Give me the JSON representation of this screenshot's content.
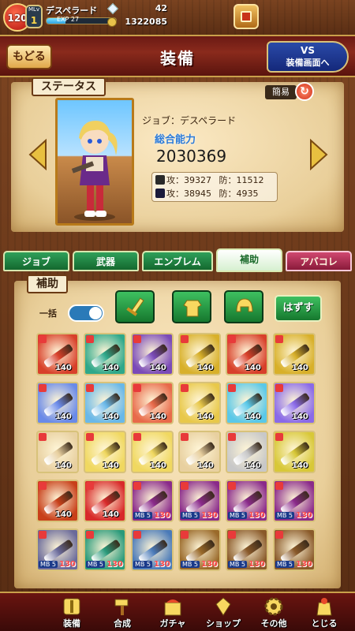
{
  "topbar": {
    "rank": "120",
    "mlv_label": "MLv",
    "mlv_value": "1",
    "player_name": "デスペラード",
    "exp_label": "EXP 27",
    "exp_fraction": 0.27,
    "gems": "42",
    "gold": "1322085"
  },
  "header": {
    "back_label": "もどる",
    "title": "装備",
    "vs_line1": "VS",
    "vs_line2": "装備画面へ"
  },
  "status": {
    "tag": "ステータス",
    "simple_label": "簡易",
    "job": "ジョブ：デスペラード",
    "power_label": "総合能力",
    "power_value": "2030369",
    "row1_attack": "攻：39327",
    "row1_defense": "防：11512",
    "row2_attack": "攻：38945",
    "row2_defense": "防：4935"
  },
  "tabs": [
    {
      "label": "ジョブ",
      "active": false
    },
    {
      "label": "武器",
      "active": false
    },
    {
      "label": "エンブレム",
      "active": false
    },
    {
      "label": "補助",
      "active": true
    },
    {
      "label": "アバコレ",
      "active": false
    }
  ],
  "inventory": {
    "tag": "補助",
    "bulk_label": "一括",
    "bulk_on": true,
    "unequip_label": "はずす",
    "filter_icons": [
      "sword-icon",
      "armor-icon",
      "helmet-icon"
    ],
    "items": [
      {
        "lv": "140",
        "color": "#d8402a"
      },
      {
        "lv": "140",
        "color": "#2fa88a"
      },
      {
        "lv": "140",
        "color": "#7a4ab8"
      },
      {
        "lv": "140",
        "color": "#d8b02a"
      },
      {
        "lv": "140",
        "color": "#d8402a"
      },
      {
        "lv": "140",
        "color": "#d8b02a"
      },
      {
        "lv": "140",
        "color": "#6a8ae8"
      },
      {
        "lv": "140",
        "color": "#6ab8e8"
      },
      {
        "lv": "140",
        "color": "#e86a4a"
      },
      {
        "lv": "140",
        "color": "#e8c84a"
      },
      {
        "lv": "140",
        "color": "#5ac8e8"
      },
      {
        "lv": "140",
        "color": "#8a6ae8"
      },
      {
        "lv": "140",
        "color": "#e8d0a0"
      },
      {
        "lv": "140",
        "color": "#f0d860"
      },
      {
        "lv": "140",
        "color": "#f0d860"
      },
      {
        "lv": "140",
        "color": "#e8d0a0"
      },
      {
        "lv": "140",
        "color": "#c8c8c8"
      },
      {
        "lv": "140",
        "color": "#d8c838"
      },
      {
        "lv": "140",
        "color": "#c8401a"
      },
      {
        "lv": "140",
        "color": "#d82a2a"
      },
      {
        "mb": "MB 5",
        "n": "130",
        "color": "#8a2a8a"
      },
      {
        "mb": "MB 5",
        "n": "130",
        "color": "#8a2a8a"
      },
      {
        "mb": "MB 5",
        "n": "130",
        "color": "#8a2a8a"
      },
      {
        "mb": "MB 5",
        "n": "130",
        "color": "#8a2a8a"
      },
      {
        "mb": "MB 5",
        "n": "130",
        "color": "#6a6a9a"
      },
      {
        "mb": "MB 5",
        "n": "130",
        "color": "#2a9a7a"
      },
      {
        "mb": "MB 5",
        "n": "130",
        "color": "#4a7ab8"
      },
      {
        "mb": "MB 5",
        "n": "130",
        "color": "#9a6a2a"
      },
      {
        "mb": "MB 5",
        "n": "130",
        "color": "#8a5a2a"
      },
      {
        "mb": "MB 5",
        "n": "130",
        "color": "#8a5a2a"
      }
    ]
  },
  "nav": [
    {
      "label": "装備",
      "icon": "equipment-icon"
    },
    {
      "label": "合成",
      "icon": "hammer-icon"
    },
    {
      "label": "ガチャ",
      "icon": "gacha-icon"
    },
    {
      "label": "ショップ",
      "icon": "shop-crystal-icon"
    },
    {
      "label": "その他",
      "icon": "gear-icon"
    },
    {
      "label": "とじる",
      "icon": "close-bag-icon"
    }
  ]
}
